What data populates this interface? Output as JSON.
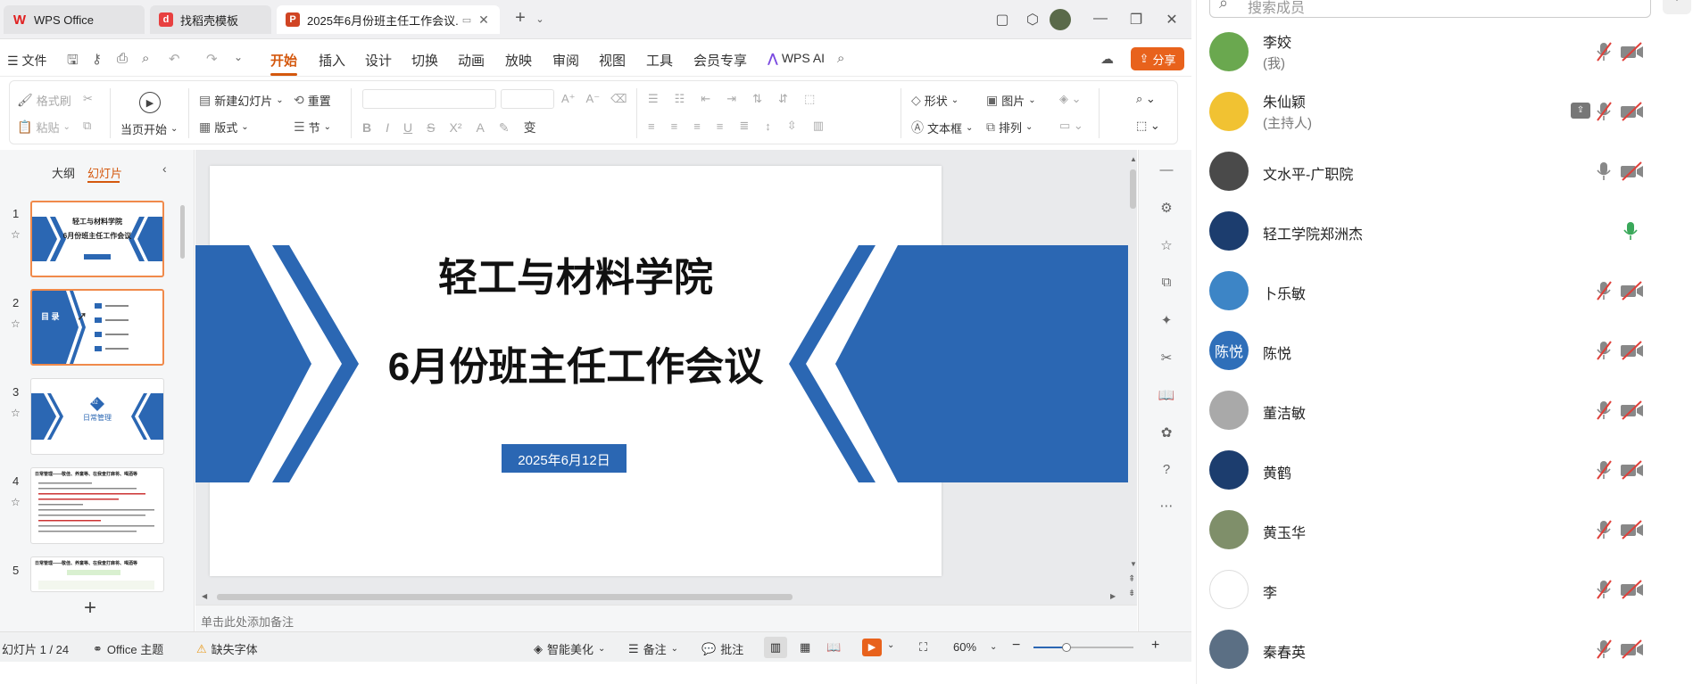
{
  "tabs": [
    {
      "label": "WPS Office",
      "icon": "wps-logo-icon",
      "color": "#e02020"
    },
    {
      "label": "找稻壳模板",
      "icon": "docer-icon",
      "color": "#e84040"
    },
    {
      "label": "2025年6月份班主任工作会议.",
      "icon": "ppt-icon",
      "color": "#d04423"
    }
  ],
  "menu": {
    "file": "文件",
    "items": [
      "开始",
      "插入",
      "设计",
      "切换",
      "动画",
      "放映",
      "审阅",
      "视图",
      "工具",
      "会员专享"
    ],
    "active": "开始",
    "wps_ai": "WPS AI",
    "share": "分享"
  },
  "ribbon": {
    "format_painter": "格式刷",
    "paste": "粘贴",
    "play_from_current": "当页开始",
    "new_slide": "新建幻灯片",
    "layout": "版式",
    "reset": "重置",
    "section": "节",
    "shape": "形状",
    "textbox": "文本框",
    "picture": "图片",
    "arrange": "排列"
  },
  "left_panel": {
    "tab_outline": "大纲",
    "tab_slides": "幻灯片",
    "slides": [
      {
        "num": "1",
        "title": "轻工与材料学院",
        "subtitle": "6月份班主任工作会议"
      },
      {
        "num": "2",
        "title": "目 录"
      },
      {
        "num": "3",
        "title": "日常管理",
        "badge": "02"
      },
      {
        "num": "4",
        "title": "日常管理——敬佳、养童等、在我查打麻将、喝酒等"
      },
      {
        "num": "5",
        "title": "日常管理——敬佳、养童等、在我查打麻将、喝酒等"
      }
    ]
  },
  "slide": {
    "title": "轻工与材料学院",
    "subtitle": "6月份班主任工作会议",
    "date": "2025年6月12日",
    "accent": "#2b67b3"
  },
  "notes_placeholder": "单击此处添加备注",
  "status": {
    "slide_count": "幻灯片 1 / 24",
    "theme": "Office 主题",
    "missing_font": "缺失字体",
    "smart_beautify": "智能美化",
    "notes": "备注",
    "comments": "批注",
    "zoom": "60%"
  },
  "meeting": {
    "search_placeholder": "搜索成员",
    "members": [
      {
        "name": "李姣",
        "role": "(我)",
        "mic": "muted",
        "cam": "off"
      },
      {
        "name": "朱仙颖",
        "role": "(主持人)",
        "mic": "muted",
        "cam": "off",
        "sharing": true
      },
      {
        "name": "文水平-广职院",
        "role": "",
        "mic": "on",
        "cam": "off"
      },
      {
        "name": "轻工学院郑洲杰",
        "role": "",
        "mic": "speaking",
        "cam": "none"
      },
      {
        "name": "卜乐敏",
        "role": "",
        "mic": "muted",
        "cam": "off"
      },
      {
        "name": "陈悦",
        "role": "",
        "mic": "muted",
        "cam": "off",
        "avatar_text": "陈悦"
      },
      {
        "name": "董洁敏",
        "role": "",
        "mic": "muted",
        "cam": "off"
      },
      {
        "name": "黄鹤",
        "role": "",
        "mic": "muted",
        "cam": "off"
      },
      {
        "name": "黄玉华",
        "role": "",
        "mic": "muted",
        "cam": "off"
      },
      {
        "name": "李",
        "role": "",
        "mic": "muted",
        "cam": "off"
      },
      {
        "name": "秦春英",
        "role": "",
        "mic": "muted",
        "cam": "off"
      }
    ]
  }
}
